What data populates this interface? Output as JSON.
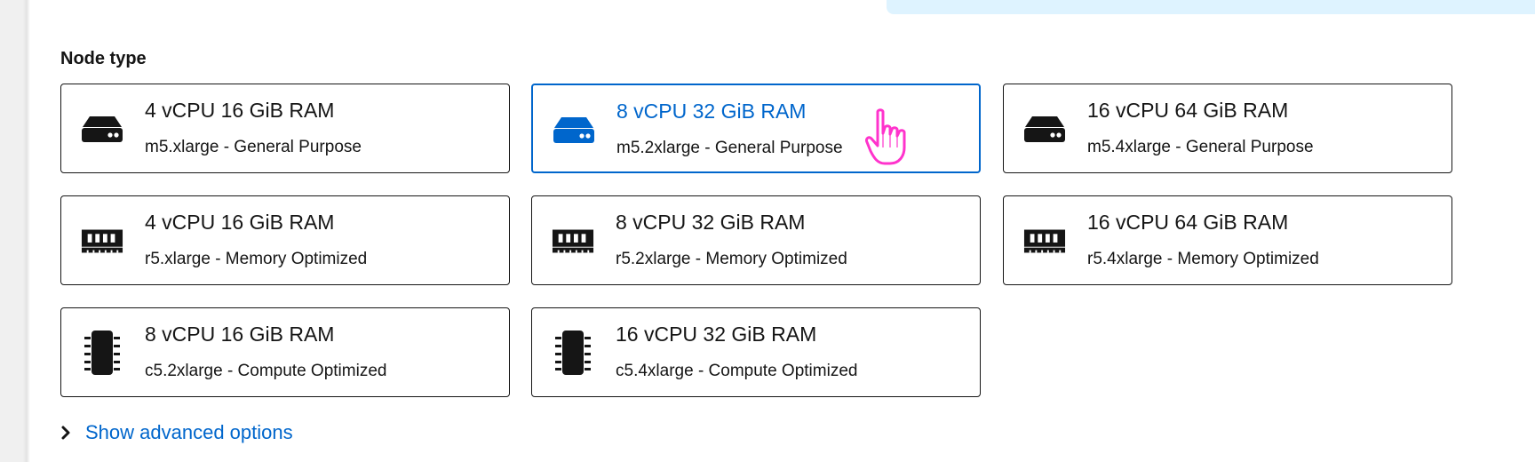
{
  "section": {
    "label": "Node type"
  },
  "tiles": [
    {
      "title": "4 vCPU 16 GiB RAM",
      "desc": "m5.xlarge - General Purpose",
      "icon": "server-icon",
      "selected": false
    },
    {
      "title": "8 vCPU 32 GiB RAM",
      "desc": "m5.2xlarge - General Purpose",
      "icon": "server-icon",
      "selected": true
    },
    {
      "title": "16 vCPU 64 GiB RAM",
      "desc": "m5.4xlarge - General Purpose",
      "icon": "server-icon",
      "selected": false
    },
    {
      "title": "4 vCPU 16 GiB RAM",
      "desc": "r5.xlarge - Memory Optimized",
      "icon": "memory-icon",
      "selected": false
    },
    {
      "title": "8 vCPU 32 GiB RAM",
      "desc": "r5.2xlarge - Memory Optimized",
      "icon": "memory-icon",
      "selected": false
    },
    {
      "title": "16 vCPU 64 GiB RAM",
      "desc": "r5.4xlarge - Memory Optimized",
      "icon": "memory-icon",
      "selected": false
    },
    {
      "title": "8 vCPU 16 GiB RAM",
      "desc": "c5.2xlarge - Compute Optimized",
      "icon": "microchip-icon",
      "selected": false
    },
    {
      "title": "16 vCPU 32 GiB RAM",
      "desc": "c5.4xlarge - Compute Optimized",
      "icon": "microchip-icon",
      "selected": false
    }
  ],
  "advanced": {
    "label": "Show advanced options"
  },
  "colors": {
    "accent": "#0066cc",
    "text": "#151515",
    "banner": "#def3ff",
    "cursor": "#ff33cc"
  }
}
